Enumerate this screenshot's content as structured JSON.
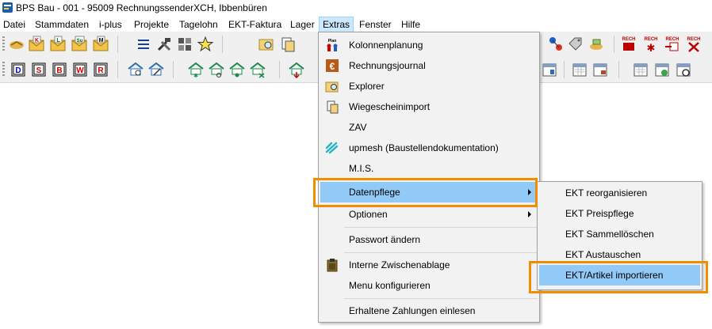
{
  "window": {
    "title": "BPS Bau - 001 - 95009 RechnungssenderXCH, Ibbenbüren",
    "icon": "bps-app-icon"
  },
  "menubar": {
    "items": [
      {
        "label": "Datei"
      },
      {
        "label": "Stammdaten"
      },
      {
        "label": "i-plus"
      },
      {
        "label": "Projekte"
      },
      {
        "label": "Tagelohn"
      },
      {
        "label": "EKT-Faktura"
      },
      {
        "label": "Lager"
      },
      {
        "label": "Extras",
        "active": true
      },
      {
        "label": "Fenster"
      },
      {
        "label": "Hilfe"
      }
    ]
  },
  "toolbar_icons": {
    "letters_k": "K",
    "letters_l": "L",
    "letters_su": "Su",
    "letters_m": "M",
    "doc_d": "D",
    "doc_s": "S",
    "doc_b": "B",
    "doc_w": "W",
    "doc_r": "R",
    "rech_label": "RECH",
    "plan_label": "Plan"
  },
  "extras_menu": {
    "items": [
      {
        "label": "Kolonnenplanung",
        "icon": "kolonnenplanung-icon"
      },
      {
        "label": "Rechnungsjournal",
        "icon": "rechnungsjournal-icon"
      },
      {
        "label": "Explorer",
        "icon": "explorer-icon"
      },
      {
        "label": "Wiegescheinimport",
        "icon": "wiegeschein-icon"
      },
      {
        "label": "ZAV",
        "icon": ""
      },
      {
        "label": "upmesh (Baustellendokumentation)",
        "icon": "upmesh-icon"
      },
      {
        "label": "M.I.S.",
        "icon": ""
      },
      {
        "label": "Datenpflege",
        "icon": "",
        "submenu": true,
        "highlighted": true
      },
      {
        "label": "Optionen",
        "icon": "",
        "submenu": true
      },
      {
        "label": "Passwort ändern",
        "icon": ""
      },
      {
        "label": "Interne Zwischenablage",
        "icon": "clipboard-icon"
      },
      {
        "label": "Menu konfigurieren",
        "icon": ""
      },
      {
        "label": "Erhaltene Zahlungen einlesen",
        "icon": ""
      }
    ]
  },
  "datenpflege_submenu": {
    "items": [
      {
        "label": "EKT reorganisieren"
      },
      {
        "label": "EKT Preispflege"
      },
      {
        "label": "EKT Sammellöschen"
      },
      {
        "label": "EKT Austauschen"
      },
      {
        "label": "EKT/Artikel importieren",
        "highlighted": true
      }
    ]
  },
  "colors": {
    "menu_highlight": "#91c9f7",
    "callout": "#f28c00",
    "menu_bg": "#f2f2f2",
    "toolbar_bg": "#f0f0f0"
  }
}
